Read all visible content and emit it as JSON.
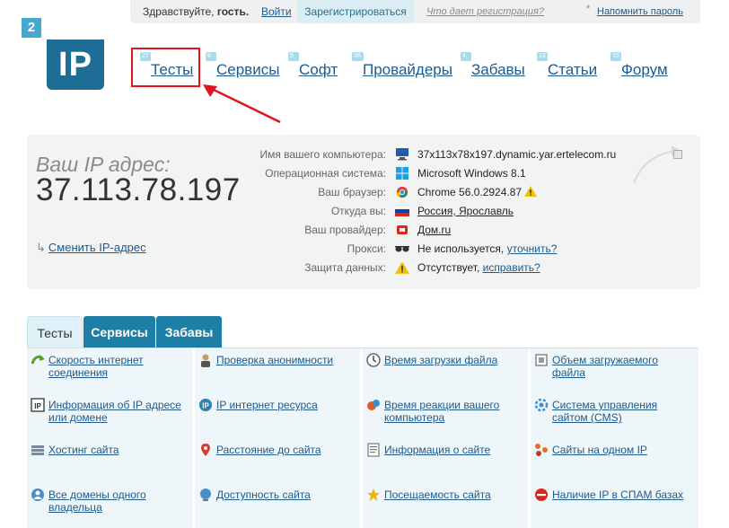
{
  "topbar": {
    "greeting": "Здравствуйте,",
    "guest": "гость.",
    "login": "Войти",
    "register": "Зарегистрироваться",
    "what_registration": "Что дает регистрация?",
    "star": "*",
    "remind_password": "Напомнить пароль"
  },
  "logo": {
    "small": "2",
    "main": "IP"
  },
  "nav": [
    {
      "badge": "27",
      "label": "Тесты"
    },
    {
      "badge": "9",
      "label": "Сервисы"
    },
    {
      "badge": "5",
      "label": "Софт"
    },
    {
      "badge": "3K",
      "label": "Провайдеры"
    },
    {
      "badge": "4",
      "label": "Забавы"
    },
    {
      "badge": "13",
      "label": "Статьи"
    },
    {
      "badge": "15",
      "label": "Форум"
    }
  ],
  "ip_panel": {
    "title": "Ваш IP адрес:",
    "ip": "37.113.78.197",
    "change_ip": "Сменить IP-адрес",
    "rows": [
      {
        "label": "Имя вашего компьютера:",
        "icon": "computer-icon",
        "value": "37x113x78x197.dynamic.yar.ertelecom.ru",
        "link": ""
      },
      {
        "label": "Операционная система:",
        "icon": "windows-icon",
        "value": "Microsoft Windows 8.1",
        "link": ""
      },
      {
        "label": "Ваш браузер:",
        "icon": "chrome-icon",
        "value": "Chrome 56.0.2924.87",
        "link": "",
        "warning": true
      },
      {
        "label": "Откуда вы:",
        "icon": "russia-flag-icon",
        "value": "",
        "link": "Россия, Ярославль"
      },
      {
        "label": "Ваш провайдер:",
        "icon": "provider-icon",
        "value": "",
        "link": "Дом.ru"
      },
      {
        "label": "Прокси:",
        "icon": "sunglasses-icon",
        "value": "Не используется,",
        "link": "уточнить?"
      },
      {
        "label": "Защита данных:",
        "icon": "warning-icon",
        "value": "Отсутствует,",
        "link": "исправить?"
      }
    ]
  },
  "tabs": [
    {
      "label": "Тесты",
      "active": true
    },
    {
      "label": "Сервисы",
      "active": false
    },
    {
      "label": "Забавы",
      "active": false
    }
  ],
  "grid": [
    {
      "icon": "speed-arrow-icon",
      "label": "Скорость интернет соединения"
    },
    {
      "icon": "anonymity-icon",
      "label": "Проверка анонимности"
    },
    {
      "icon": "clock-icon",
      "label": "Время загрузки файла"
    },
    {
      "icon": "file-volume-icon",
      "label": "Объем загружаемого файла"
    },
    {
      "icon": "ip-info-icon",
      "label": "Информация об IP адресе или домене"
    },
    {
      "icon": "ip-resource-icon",
      "label": "IP интернет ресурса"
    },
    {
      "icon": "reaction-icon",
      "label": "Время реакции вашего компьютера"
    },
    {
      "icon": "cms-icon",
      "label": "Система управления сайтом (CMS)"
    },
    {
      "icon": "hosting-icon",
      "label": "Хостинг сайта"
    },
    {
      "icon": "location-pin-icon",
      "label": "Расстояние до сайта"
    },
    {
      "icon": "site-info-icon",
      "label": "Информация о сайте"
    },
    {
      "icon": "same-ip-icon",
      "label": "Сайты на одном IP"
    },
    {
      "icon": "domains-owner-icon",
      "label": "Все домены одного владельца"
    },
    {
      "icon": "availability-icon",
      "label": "Доступность сайта"
    },
    {
      "icon": "star-icon",
      "label": "Посещаемость сайта"
    },
    {
      "icon": "spam-icon",
      "label": "Наличие IP в СПАМ базах"
    }
  ]
}
